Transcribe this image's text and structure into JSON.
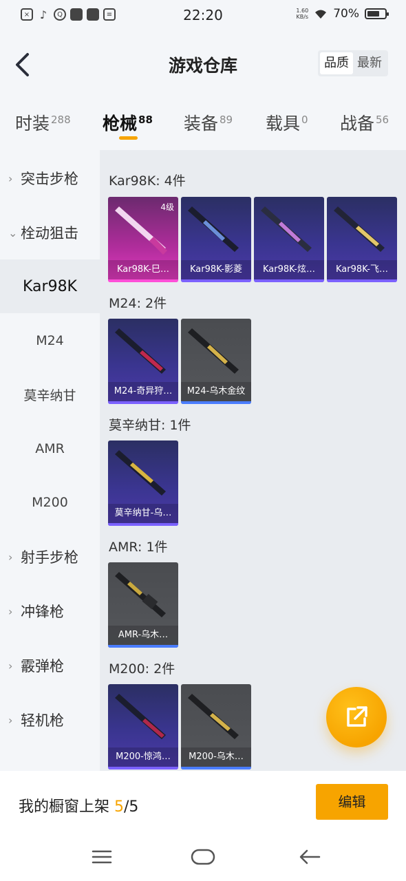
{
  "status_bar": {
    "time": "22:20",
    "speed_top": "1.60",
    "speed_unit": "KB/s",
    "battery": "70%",
    "left_icons": [
      "sim-icon",
      "tiktok-icon",
      "q-icon",
      "app-icon",
      "app2-icon",
      "calendar-icon"
    ]
  },
  "header": {
    "title": "游戏仓库",
    "sort_options": [
      "品质",
      "最新"
    ],
    "active_sort": "品质"
  },
  "tabs": [
    {
      "label": "时装",
      "count": "288"
    },
    {
      "label": "枪械",
      "count": "88"
    },
    {
      "label": "装备",
      "count": "89"
    },
    {
      "label": "载具",
      "count": "0"
    },
    {
      "label": "战备",
      "count": "56"
    }
  ],
  "active_tab": "枪械",
  "sidebar": [
    {
      "label": "突击步枪",
      "type": "parent",
      "expanded": false
    },
    {
      "label": "栓动狙击",
      "type": "parent",
      "expanded": true
    },
    {
      "label": "Kar98K",
      "type": "child",
      "active": true
    },
    {
      "label": "M24",
      "type": "child"
    },
    {
      "label": "莫辛纳甘",
      "type": "child"
    },
    {
      "label": "AMR",
      "type": "child"
    },
    {
      "label": "M200",
      "type": "child"
    },
    {
      "label": "射手步枪",
      "type": "parent",
      "expanded": false
    },
    {
      "label": "冲锋枪",
      "type": "parent",
      "expanded": false
    },
    {
      "label": "霰弹枪",
      "type": "parent",
      "expanded": false
    },
    {
      "label": "轻机枪",
      "type": "parent",
      "expanded": false
    }
  ],
  "groups": [
    {
      "title": "Kar98K: 4件",
      "items": [
        {
          "label": "Kar98K-巳…",
          "tier": "pink",
          "badge": "4级"
        },
        {
          "label": "Kar98K-影菱",
          "tier": "purple",
          "badge": ""
        },
        {
          "label": "Kar98K-炫…",
          "tier": "purple",
          "badge": ""
        },
        {
          "label": "Kar98K-飞…",
          "tier": "purple",
          "badge": ""
        }
      ]
    },
    {
      "title": "M24: 2件",
      "items": [
        {
          "label": "M24-奇异狩…",
          "tier": "purple",
          "badge": ""
        },
        {
          "label": "M24-乌木金纹",
          "tier": "gray",
          "badge": ""
        }
      ]
    },
    {
      "title": "莫辛纳甘: 1件",
      "items": [
        {
          "label": "莫辛纳甘-乌…",
          "tier": "purple",
          "badge": ""
        }
      ]
    },
    {
      "title": "AMR: 1件",
      "items": [
        {
          "label": "AMR-乌木…",
          "tier": "gray",
          "badge": ""
        }
      ]
    },
    {
      "title": "M200: 2件",
      "items": [
        {
          "label": "M200-惊鸿…",
          "tier": "purple",
          "badge": ""
        },
        {
          "label": "M200-乌木…",
          "tier": "gray",
          "badge": ""
        }
      ]
    }
  ],
  "bottom": {
    "text_prefix": "我的橱窗上架 ",
    "count_current": "5",
    "count_total": "/5",
    "edit_label": "编辑"
  },
  "colors": {
    "accent": "#f7a400",
    "purple_tier": "#3a3590",
    "pink_tier": "#e33bc0",
    "gray_tier": "#55575b"
  },
  "fab_icon": "share-external-icon"
}
